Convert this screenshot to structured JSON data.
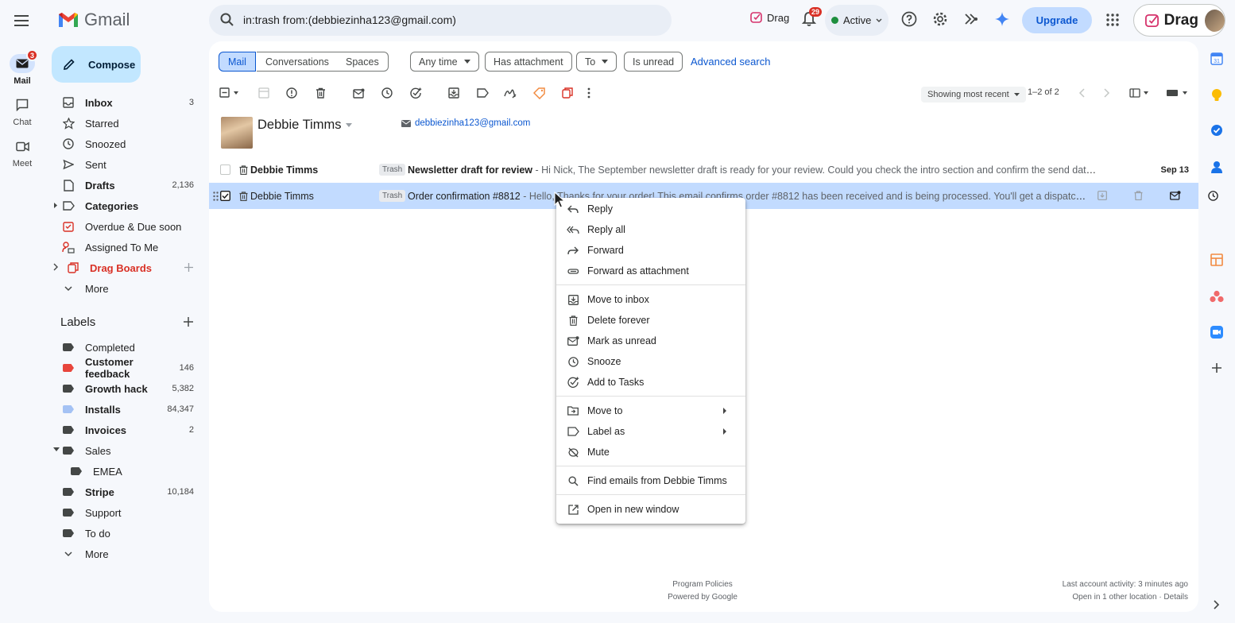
{
  "header": {
    "app_name": "Gmail",
    "search_value": "in:trash from:(debbiezinha123@gmail.com)",
    "drag_label": "Drag",
    "notifications_count": "29",
    "status_label": "Active",
    "upgrade_label": "Upgrade",
    "account_brand": "Drag"
  },
  "rail": {
    "mail_label": "Mail",
    "mail_badge": "3",
    "chat_label": "Chat",
    "meet_label": "Meet"
  },
  "compose_label": "Compose",
  "nav": [
    {
      "label": "Inbox",
      "count": "3"
    },
    {
      "label": "Starred",
      "count": ""
    },
    {
      "label": "Snoozed",
      "count": ""
    },
    {
      "label": "Sent",
      "count": ""
    },
    {
      "label": "Drafts",
      "count": "2,136"
    },
    {
      "label": "Categories",
      "count": ""
    },
    {
      "label": "Overdue & Due soon",
      "count": ""
    },
    {
      "label": "Assigned To Me",
      "count": ""
    },
    {
      "label": "Drag Boards",
      "count": ""
    },
    {
      "label": "More",
      "count": ""
    }
  ],
  "labels_section": {
    "title": "Labels",
    "items": [
      {
        "label": "Completed",
        "count": "",
        "color": "#444746"
      },
      {
        "label": "Customer feedback",
        "count": "146",
        "color": "#e8453c"
      },
      {
        "label": "Growth hack",
        "count": "5,382",
        "color": "#444746"
      },
      {
        "label": "Installs",
        "count": "84,347",
        "color": "#a4c2f4"
      },
      {
        "label": "Invoices",
        "count": "2",
        "color": "#444746"
      },
      {
        "label": "Sales",
        "count": "",
        "color": "#444746"
      },
      {
        "label": "EMEA",
        "count": "",
        "color": "#444746"
      },
      {
        "label": "Stripe",
        "count": "10,184",
        "color": "#444746"
      },
      {
        "label": "Support",
        "count": "",
        "color": "#444746"
      },
      {
        "label": "To do",
        "count": "",
        "color": "#444746"
      }
    ],
    "more_label": "More"
  },
  "filters": {
    "mail": "Mail",
    "conversations": "Conversations",
    "spaces": "Spaces",
    "any_time": "Any time",
    "has_attachment": "Has attachment",
    "to": "To",
    "is_unread": "Is unread",
    "advanced_search": "Advanced search"
  },
  "toolbar": {
    "showing": "Showing most recent",
    "pager": "1–2 of 2"
  },
  "contact": {
    "name": "Debbie Timms",
    "email": "debbiezinha123@gmail.com"
  },
  "emails": [
    {
      "sender": "Debbie Timms",
      "badge": "Trash",
      "subject": "Newsletter draft for review",
      "snippet": " - Hi Nick, The September newsletter draft is ready for your review. Could you check the intro section and confirm the send date? Thanks!",
      "date": "Sep 13"
    },
    {
      "sender": "Debbie Timms",
      "badge": "Trash",
      "subject": "Order confirmation #8812",
      "snippet": " - Hello, Thanks for your order! This email confirms order #8812 has been received and is being processed. You'll get a dispatch notification …",
      "date": ""
    }
  ],
  "context_menu": [
    {
      "label": "Reply",
      "icon": "reply-icon"
    },
    {
      "label": "Reply all",
      "icon": "reply-all-icon"
    },
    {
      "label": "Forward",
      "icon": "forward-icon"
    },
    {
      "label": "Forward as attachment",
      "icon": "attachment-icon"
    },
    {
      "label": "Move to inbox",
      "icon": "move-to-inbox-icon"
    },
    {
      "label": "Delete forever",
      "icon": "trash-icon"
    },
    {
      "label": "Mark as unread",
      "icon": "mark-unread-icon"
    },
    {
      "label": "Snooze",
      "icon": "clock-icon"
    },
    {
      "label": "Add to Tasks",
      "icon": "add-task-icon"
    },
    {
      "label": "Move to",
      "icon": "folder-move-icon"
    },
    {
      "label": "Label as",
      "icon": "label-icon"
    },
    {
      "label": "Mute",
      "icon": "mute-icon"
    },
    {
      "label": "Find emails from Debbie Timms",
      "icon": "search-icon"
    },
    {
      "label": "Open in new window",
      "icon": "open-new-window-icon"
    }
  ],
  "footer": {
    "program_policies": "Program Policies",
    "powered_by": "Powered by Google",
    "last_activity": "Last account activity: 3 minutes ago",
    "open_location": "Open in 1 other location · Details"
  }
}
